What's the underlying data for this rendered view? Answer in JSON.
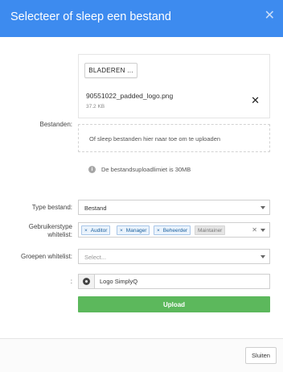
{
  "dialog": {
    "title": "Selecteer of sleep een bestand",
    "close_glyph": "✕"
  },
  "files": {
    "label": "Bestanden:",
    "browse_label": "BLADEREN ...",
    "file_name": "90551022_padded_logo.png",
    "file_size": "37.2 KB",
    "remove_glyph": "✕",
    "dropzone_text": "Of sleep bestanden hier naar toe om te uploaden",
    "limit_text": "De bestandsuploadlimiet is 30MB"
  },
  "type": {
    "label": "Type bestand:",
    "value": "Bestand"
  },
  "user_types": {
    "label_line1": "Gebruikerstype",
    "label_line2": "whitelist:",
    "tags": [
      "Auditor",
      "Manager",
      "Beheerder"
    ],
    "disabled_tag": "Maintainer",
    "clear_glyph": "✕"
  },
  "groups": {
    "label": "Groepen whitelist:",
    "placeholder": "Select..."
  },
  "logo_option": {
    "label": ":",
    "value": "Logo SimplyQ"
  },
  "upload_label": "Upload",
  "footer": {
    "close_label": "Sluiten"
  },
  "icons": {
    "info": "info-icon",
    "radio": "radio-selected-icon",
    "caret": "chevron-down-icon"
  },
  "colors": {
    "header": "#3d8bef",
    "upload": "#5cb85c",
    "tag_bg": "#eaf3fc",
    "tag_text": "#1a5f9e"
  }
}
